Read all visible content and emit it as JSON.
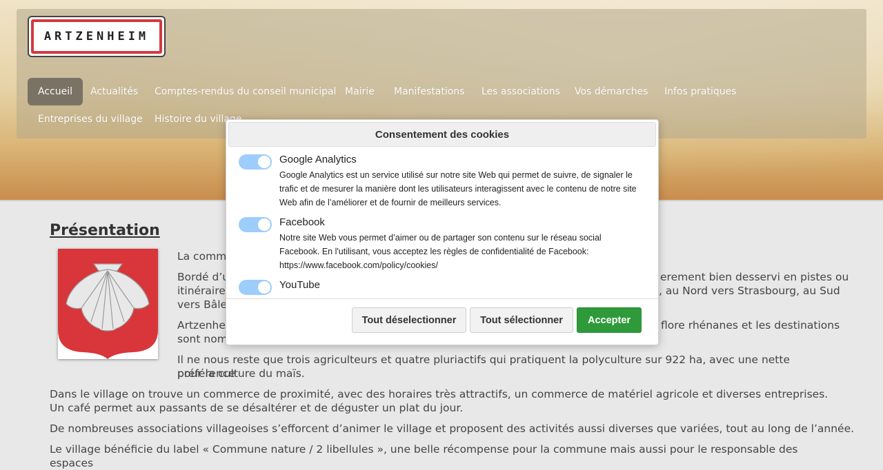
{
  "site": {
    "logo_text": "ARTZENHEIM",
    "nav": [
      "Accueil",
      "Actualités",
      "Comptes-rendus du conseil municipal",
      "Mairie",
      "Manifestations",
      "Les associations",
      "Vos démarches",
      "Infos pratiques",
      "Entreprises du village",
      "Histoire du village"
    ]
  },
  "main": {
    "title": "Présentation",
    "paragraphs": [
      "La comm",
      "Bordé d’u",
      "erement bien desservi en pistes ou",
      "itinéraires",
      ", au Nord vers Strasbourg, au Sud",
      "vers Bâle",
      "Artzenhe",
      "flore rhénanes et les destinations",
      "sont nom",
      "Il ne nous reste que trois agriculteurs et quatre pluriactifs qui pratiquent la polyculture sur 922 ha, avec une nette préférence",
      "pour la culture du maïs.",
      "Dans le village on trouve un commerce de proximité, avec des horaires très attractifs, un commerce de matériel agricole et diverses entreprises.",
      "Un café permet aux passants de se désaltérer et de déguster un plat du jour.",
      "De nombreuses associations villageoises s’efforcent d’animer le village et proposent des activités aussi diverses que variées, tout au long de l’année.",
      "Le village bénéficie du label « Commune nature / 2 libellules », une belle récompense pour la commune mais aussi pour le responsable des espaces"
    ]
  },
  "cookie_modal": {
    "title": "Consentement des cookies",
    "options": [
      {
        "name": "Google Analytics",
        "enabled": true,
        "description": [
          "Google Analytics est un service utilisé sur notre site Web qui permet de suivre, de signaler le",
          "trafic et de mesurer la manière dont les utilisateurs interagissent avec le contenu de notre site",
          "Web afin de l’améliorer et de fournir de meilleurs services."
        ]
      },
      {
        "name": "Facebook",
        "enabled": true,
        "description": [
          "Notre site Web vous permet d’aimer ou de partager son contenu sur le réseau social",
          "Facebook. En l'utilisant, vous acceptez les règles de confidentialité de Facebook:",
          "https://www.facebook.com/policy/cookies/"
        ]
      },
      {
        "name": "YouTube",
        "enabled": true,
        "description": []
      }
    ],
    "buttons": {
      "deselect_all": "Tout déselectionner",
      "select_all": "Tout sélectionner",
      "accept": "Accepter"
    }
  },
  "colors": {
    "toggle_on": "#9ccdfb",
    "accept_button": "#2e9a3a",
    "logo_border": "#d33a3f",
    "crest_red": "#d8363a"
  }
}
